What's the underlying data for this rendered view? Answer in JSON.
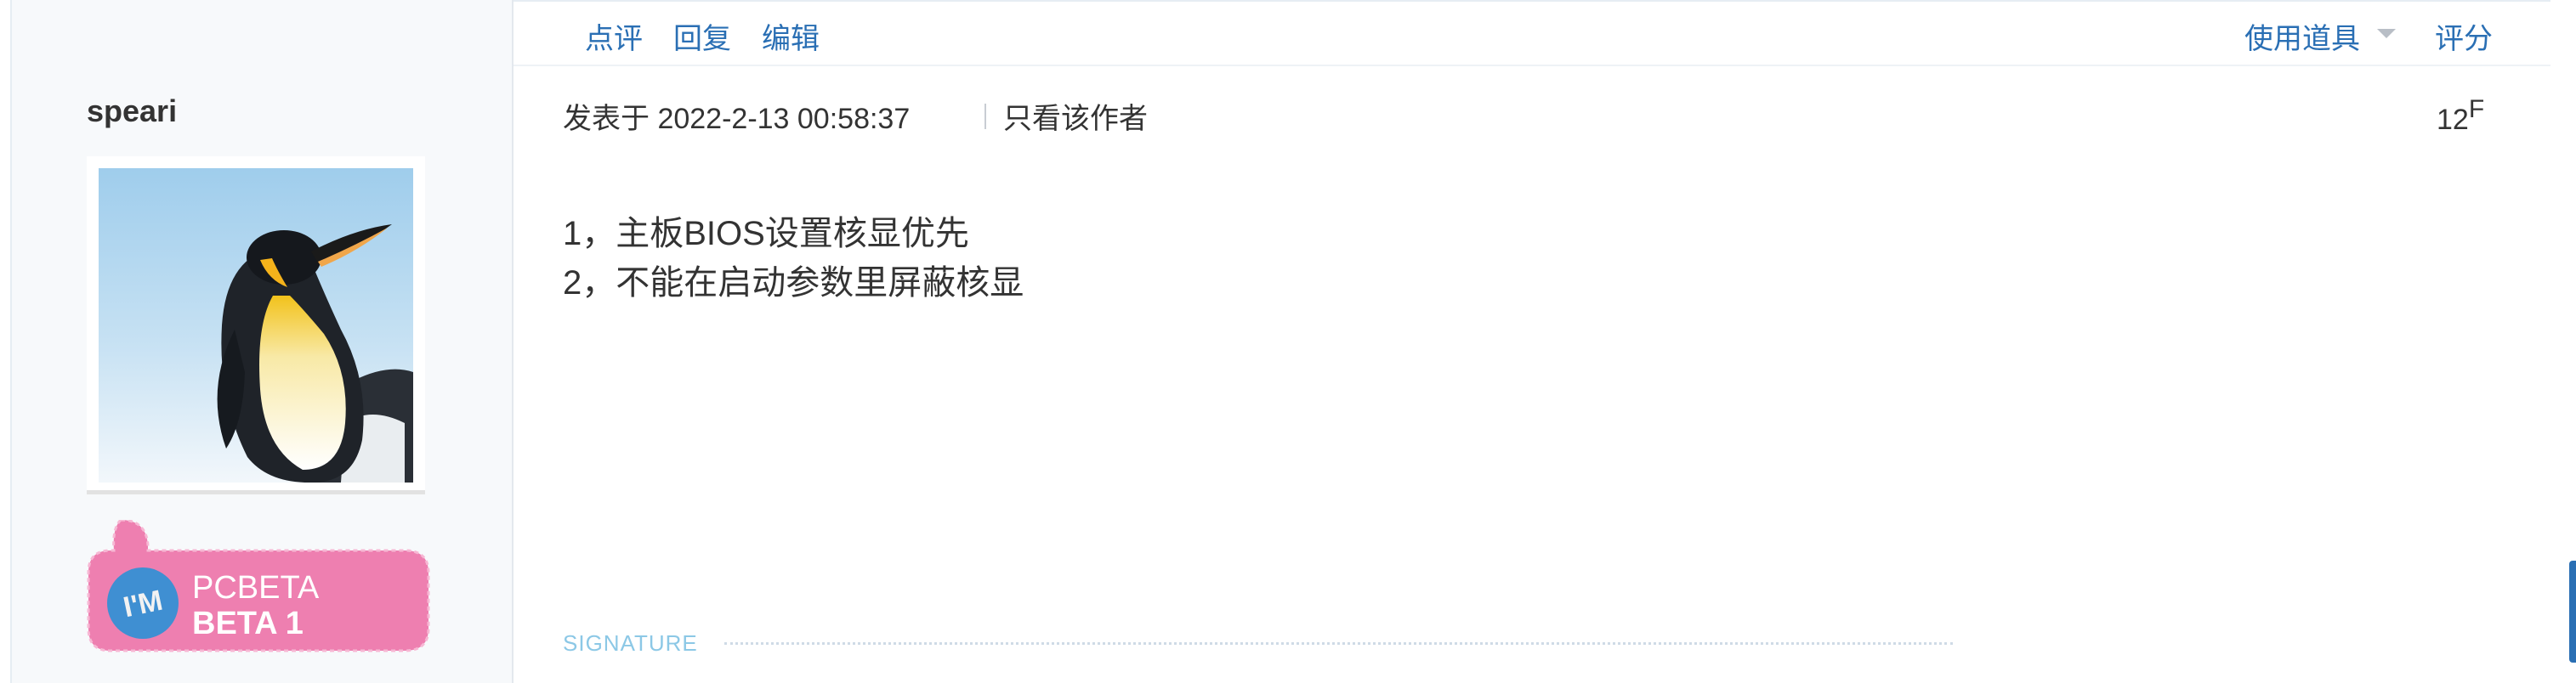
{
  "toolbar": {
    "comment": "点评",
    "reply": "回复",
    "edit": "编辑",
    "use_tool": "使用道具",
    "rate": "评分"
  },
  "user": {
    "name": "speari",
    "badge": {
      "im": "I'M",
      "line1": "PCBETA",
      "line2": "BETA 1"
    }
  },
  "post": {
    "posted_at": "发表于 2022-2-13 00:58:37",
    "only_author": "只看该作者",
    "floor_number": "12",
    "floor_suffix": "F",
    "lines": [
      "1，主板BIOS设置核显优先",
      "2，不能在启动参数里屏蔽核显"
    ],
    "signature_label": "SIGNATURE"
  },
  "colors": {
    "link": "#2a6fb4",
    "badge_pink": "#ee7fb0",
    "badge_circle": "#3f8fd2",
    "signature": "#8cc8e6"
  }
}
